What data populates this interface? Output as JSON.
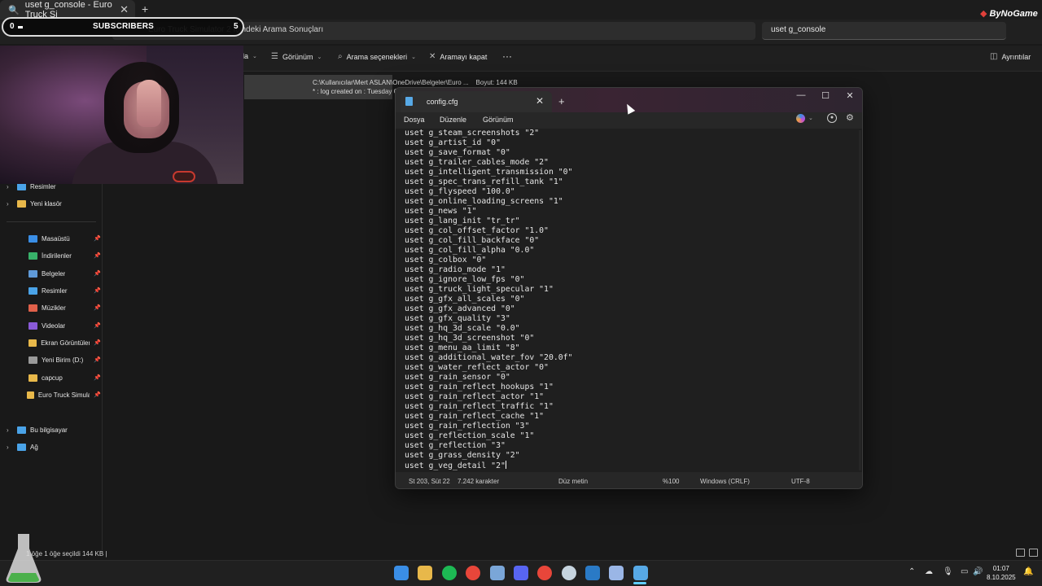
{
  "browser": {
    "tab_title": "uset g_console - Euro Truck Si",
    "tab_close": "✕",
    "new_tab": "+",
    "brand": "ByNoGame"
  },
  "explorer": {
    "address": "Euro Truck Simulator 2 İçindeki Arama Sonuçları",
    "search_value": "uset g_console",
    "commands": {
      "sort_partial": "la",
      "view": "Görünüm",
      "search_options": "Arama seçenekleri",
      "close_search": "Aramayı kapat",
      "more": "···",
      "details": "Ayrıntılar"
    },
    "result": {
      "path": "C:\\Kullanıcılar\\Mert ASLAN\\OneDrive\\Belgeler\\Euro ...",
      "size": "Boyut: 144 KB",
      "snippet": "* : log created on : Tuesday O"
    },
    "sidebar": [
      {
        "label": "Resimler",
        "chev": "›",
        "color": "#4aa3e8",
        "pin": ""
      },
      {
        "label": "Yeni klasör",
        "chev": "›",
        "color": "#e8b84a",
        "pin": ""
      },
      {
        "label": "Masaüstü",
        "chev": "",
        "color": "#3a8ee6",
        "pin": "📌"
      },
      {
        "label": "İndirilenler",
        "chev": "",
        "color": "#38b26a",
        "pin": "📌"
      },
      {
        "label": "Belgeler",
        "chev": "",
        "color": "#5f9ad8",
        "pin": "📌"
      },
      {
        "label": "Resimler",
        "chev": "",
        "color": "#4aa3e8",
        "pin": "📌"
      },
      {
        "label": "Müzikler",
        "chev": "",
        "color": "#e0604a",
        "pin": "📌"
      },
      {
        "label": "Videolar",
        "chev": "",
        "color": "#8a5ad8",
        "pin": "📌"
      },
      {
        "label": "Ekran Görüntüleri",
        "chev": "",
        "color": "#e8b84a",
        "pin": "📌"
      },
      {
        "label": "Yeni Birim (D:)",
        "chev": "",
        "color": "#9a9a9a",
        "pin": "📌"
      },
      {
        "label": "capcup",
        "chev": "",
        "color": "#e8b84a",
        "pin": "📌"
      },
      {
        "label": "Euro Truck Simulator 2",
        "chev": "",
        "color": "#e8b84a",
        "pin": "📌"
      },
      {
        "label": "Bu bilgisayar",
        "chev": "›",
        "color": "#4aa3e8",
        "pin": ""
      },
      {
        "label": "Ağ",
        "chev": "›",
        "color": "#4aa3e8",
        "pin": ""
      }
    ],
    "status": "1 öğe   1 öğe seçildi  144 KB  |"
  },
  "overlay": {
    "subs_left": "0",
    "subs_label": "SUBSCRIBERS",
    "subs_right": "5"
  },
  "notepad": {
    "tab_title": "config.cfg",
    "menus": [
      "Dosya",
      "Düzenle",
      "Görünüm"
    ],
    "lines": [
      "uset g_steam_screenshots \"2\"",
      "uset g_artist_id \"0\"",
      "uset g_save_format \"0\"",
      "uset g_trailer_cables_mode \"2\"",
      "uset g_intelligent_transmission \"0\"",
      "uset g_spec_trans_refill_tank \"1\"",
      "uset g_flyspeed \"100.0\"",
      "uset g_online_loading_screens \"1\"",
      "uset g_news \"1\"",
      "uset g_lang_init \"tr_tr\"",
      "uset g_col_offset_factor \"1.0\"",
      "uset g_col_fill_backface \"0\"",
      "uset g_col_fill_alpha \"0.0\"",
      "uset g_colbox \"0\"",
      "uset g_radio_mode \"1\"",
      "uset g_ignore_low_fps \"0\"",
      "uset g_truck_light_specular \"1\"",
      "uset g_gfx_all_scales \"0\"",
      "uset g_gfx_advanced \"0\"",
      "uset g_gfx_quality \"3\"",
      "uset g_hq_3d_scale \"0.0\"",
      "uset g_hq_3d_screenshot \"0\"",
      "uset g_menu_aa_limit \"8\"",
      "uset g_additional_water_fov \"20.0f\"",
      "uset g_water_reflect_actor \"0\"",
      "uset g_rain_sensor \"0\"",
      "uset g_rain_reflect_hookups \"1\"",
      "uset g_rain_reflect_actor \"1\"",
      "uset g_rain_reflect_traffic \"1\"",
      "uset g_rain_reflect_cache \"1\"",
      "uset g_rain_reflection \"3\"",
      "uset g_reflection_scale \"1\"",
      "uset g_reflection \"3\"",
      "uset g_grass_density \"2\"",
      "uset g_veg_detail \"2\""
    ],
    "status": {
      "position": "St 203, Süt 22",
      "chars": "7.242 karakter",
      "format": "Düz metin",
      "zoom": "%100",
      "line_ending": "Windows (CRLF)",
      "encoding": "UTF-8"
    }
  },
  "taskbar": {
    "icons": [
      {
        "name": "start-icon",
        "color": "#3a8ee6"
      },
      {
        "name": "file-explorer-icon",
        "color": "#e8b84a"
      },
      {
        "name": "spotify-icon",
        "color": "#1db954"
      },
      {
        "name": "chrome-icon",
        "color": "#e8463a"
      },
      {
        "name": "app-icon",
        "color": "#7aa6d8"
      },
      {
        "name": "discord-icon",
        "color": "#5865f2"
      },
      {
        "name": "chrome-2-icon",
        "color": "#e8463a"
      },
      {
        "name": "steam-icon",
        "color": "#c6d4df"
      },
      {
        "name": "vscode-icon",
        "color": "#2a7ac6"
      },
      {
        "name": "app-2-icon",
        "color": "#9ab6e6"
      },
      {
        "name": "notepad-icon",
        "color": "#57a9e6"
      }
    ],
    "time": "01:07",
    "date": "8.10.2025"
  }
}
